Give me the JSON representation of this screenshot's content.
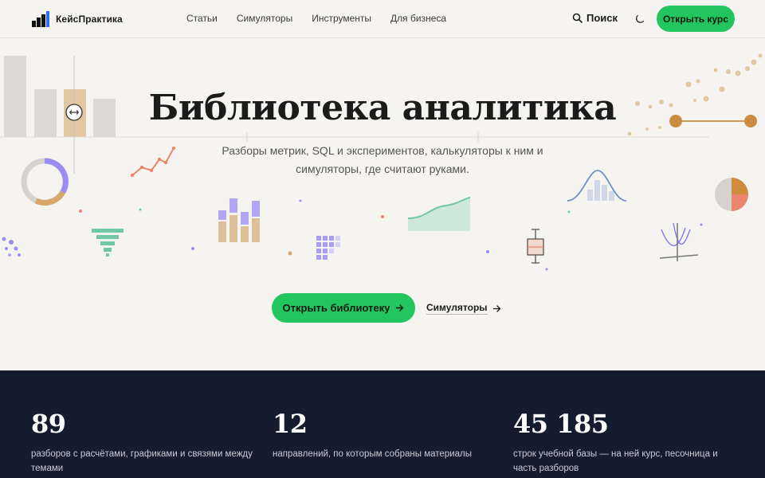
{
  "header": {
    "logo_text": "КейсПрактика",
    "nav": [
      "Статьи",
      "Симуляторы",
      "Инструменты",
      "Для бизнеса"
    ],
    "search_label": "Поиск",
    "cta_label": "Открыть курс"
  },
  "hero": {
    "title": "Библиотека аналитика",
    "subtitle": "Разборы метрик, SQL и экспериментов, калькуляторы к ним и симуляторы, где считают руками.",
    "primary_button": "Открыть библиотеку",
    "secondary_link": "Симуляторы"
  },
  "stats": [
    {
      "number": "89",
      "description": "разборов с расчётами, графиками и связями между темами"
    },
    {
      "number": "12",
      "description": "направлений, по которым собраны материалы"
    },
    {
      "number": "45 185",
      "description": "строк учебной базы — на ней курс, песочница и часть разборов"
    }
  ],
  "colors": {
    "accent_green": "#22c55e",
    "dark_navy": "#151c2f",
    "background": "#f6f4f1",
    "tan": "#c98b3f",
    "purple": "#9b8cf5",
    "teal": "#6fc7a7",
    "salmon": "#e9866b"
  }
}
